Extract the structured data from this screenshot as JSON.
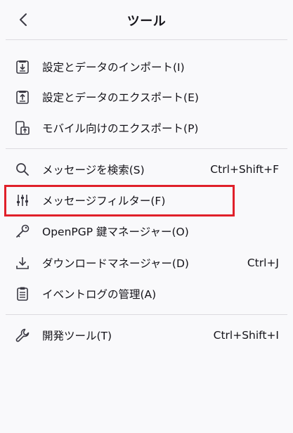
{
  "header": {
    "title": "ツール"
  },
  "menu": {
    "items": [
      {
        "label": "設定とデータのインポート(I)",
        "icon": "import-box-icon",
        "shortcut": ""
      },
      {
        "label": "設定とデータのエクスポート(E)",
        "icon": "export-box-icon",
        "shortcut": ""
      },
      {
        "label": "モバイル向けのエクスポート(P)",
        "icon": "mobile-export-icon",
        "shortcut": ""
      },
      {
        "label": "メッセージを検索(S)",
        "icon": "search-icon",
        "shortcut": "Ctrl+Shift+F"
      },
      {
        "label": "メッセージフィルター(F)",
        "icon": "filter-sliders-icon",
        "shortcut": ""
      },
      {
        "label": "OpenPGP 鍵マネージャー(O)",
        "icon": "key-icon",
        "shortcut": ""
      },
      {
        "label": "ダウンロードマネージャー(D)",
        "icon": "download-icon",
        "shortcut": "Ctrl+J"
      },
      {
        "label": "イベントログの管理(A)",
        "icon": "clipboard-icon",
        "shortcut": ""
      },
      {
        "label": "開発ツール(T)",
        "icon": "wrench-icon",
        "shortcut": "Ctrl+Shift+I"
      }
    ]
  },
  "colors": {
    "background": "#f9f9fb",
    "text": "#15141a",
    "icon": "#3b3a44",
    "highlight": "#e0202a",
    "divider": "#dcdbe0"
  }
}
